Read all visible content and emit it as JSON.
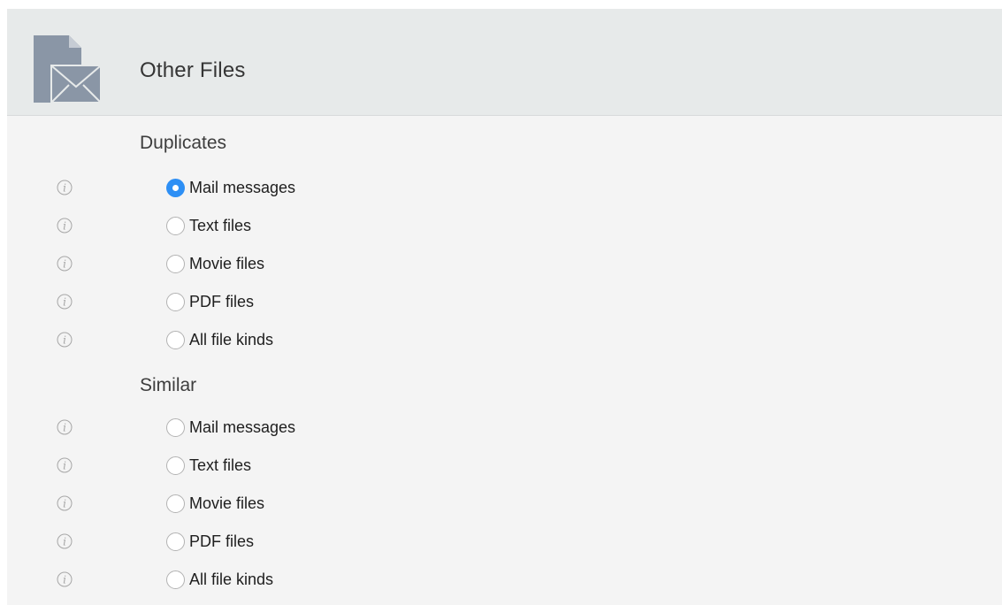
{
  "header": {
    "title": "Other Files",
    "icon": "mail-file-icon"
  },
  "sections": [
    {
      "title": "Duplicates",
      "options": [
        {
          "label": "Mail messages",
          "checked": true
        },
        {
          "label": "Text files",
          "checked": false
        },
        {
          "label": "Movie files",
          "checked": false
        },
        {
          "label": "PDF files",
          "checked": false
        },
        {
          "label": "All file kinds",
          "checked": false
        }
      ]
    },
    {
      "title": "Similar",
      "options": [
        {
          "label": "Mail messages",
          "checked": false
        },
        {
          "label": "Text files",
          "checked": false
        },
        {
          "label": "Movie files",
          "checked": false
        },
        {
          "label": "PDF files",
          "checked": false
        },
        {
          "label": "All file kinds",
          "checked": false
        }
      ]
    }
  ],
  "colors": {
    "accent": "#2d8ff5",
    "header_bg": "#e7eaea",
    "panel_bg": "#f4f4f4",
    "icon_fill": "#8a96a6"
  }
}
